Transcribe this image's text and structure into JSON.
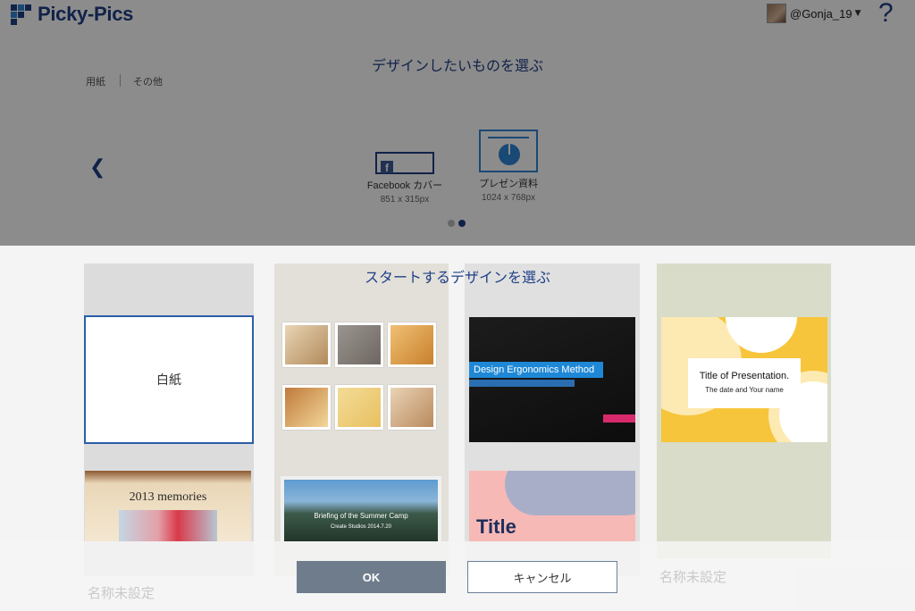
{
  "app": {
    "brand": "Picky-Pics",
    "user": "@Gonja_19",
    "help": "?"
  },
  "picker": {
    "title": "デザインしたいものを選ぶ",
    "tabs": [
      "用紙",
      "その他"
    ],
    "options": [
      {
        "name": "Facebook カバー",
        "size": "851 x 315px",
        "icon": "facebook-icon"
      },
      {
        "name": "プレゼン資料",
        "size": "1024 x 768px",
        "icon": "presentation-icon"
      }
    ],
    "page_dots": 2,
    "active_dot": 2
  },
  "modal": {
    "title": "スタートするデザインを選ぶ",
    "blank_label": "白紙",
    "templates": {
      "dark": {
        "title": "Design Ergonomics Method"
      },
      "yellow": {
        "title": "Title of Presentation.",
        "subtitle": "The date and Your name"
      },
      "memories": {
        "title": "2013 memories"
      },
      "mountain": {
        "title": "Briefing of the Summer Camp",
        "subtitle": "Create Studios  2014.7.20"
      },
      "pastel": {
        "title": "Title"
      }
    },
    "ghost_label_left": "名称未設定",
    "ghost_label_right": "名称未設定",
    "ok": "OK",
    "cancel": "キャンセル"
  },
  "colors": {
    "brand": "#1f3f86",
    "selected_border": "#2b5ea9",
    "ok_button": "#6f7c8c"
  }
}
